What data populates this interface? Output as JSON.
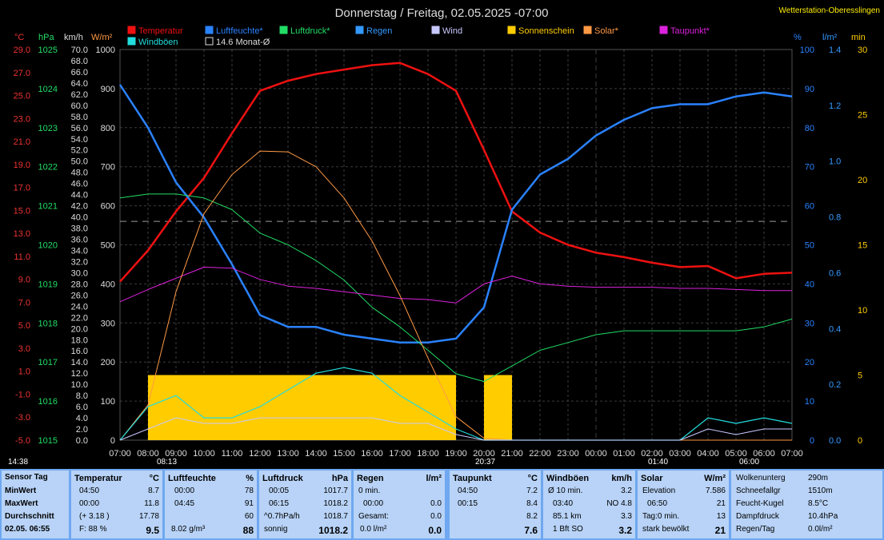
{
  "header": {
    "title": "Donnerstag / Freitag, 02.05.2025  -07:00",
    "station": "Wetterstation-Oberesslingen"
  },
  "legend": [
    {
      "label": "Temperatur",
      "color": "#ee1111"
    },
    {
      "label": "Luftfeuchte*",
      "color": "#2a82ff"
    },
    {
      "label": "Luftdruck*",
      "color": "#22dd66"
    },
    {
      "label": "Regen",
      "color": "#3399ff"
    },
    {
      "label": "Wind",
      "color": "#c8c8ff"
    },
    {
      "label": "Sonnenschein",
      "color": "#ffcc00"
    },
    {
      "label": "Solar*",
      "color": "#ff9944"
    },
    {
      "label": "Taupunkt*",
      "color": "#dd22dd"
    },
    {
      "label": "Windböen",
      "color": "#22dddd"
    },
    {
      "label": "14.6 Monat-Ø",
      "color": "#000000"
    }
  ],
  "axis_units": {
    "temp": "°C",
    "pressure": "hPa",
    "wind": "km/h",
    "solar": "W/m²",
    "humidity": "%",
    "rain": "l/m²",
    "minutes": "min"
  },
  "axis_labels": {
    "temp": [
      "29.0",
      "27.0",
      "25.0",
      "23.0",
      "21.0",
      "19.0",
      "17.0",
      "15.0",
      "13.0",
      "11.0",
      "9.0",
      "7.0",
      "5.0",
      "3.0",
      "1.0",
      "-1.0",
      "-3.0",
      "-5.0"
    ],
    "pressure": [
      "1025",
      "1024",
      "1023",
      "1022",
      "1021",
      "1020",
      "1019",
      "1018",
      "1017",
      "1016",
      "1015"
    ],
    "wind": [
      "70.0",
      "68.0",
      "66.0",
      "64.0",
      "62.0",
      "60.0",
      "58.0",
      "56.0",
      "54.0",
      "52.0",
      "50.0",
      "48.0",
      "46.0",
      "44.0",
      "42.0",
      "40.0",
      "38.0",
      "36.0",
      "34.0",
      "32.0",
      "30.0",
      "28.0",
      "26.0",
      "24.0",
      "22.0",
      "20.0",
      "18.0",
      "16.0",
      "14.0",
      "12.0",
      "10.0",
      "8.0",
      "6.0",
      "4.0",
      "2.0",
      "0.0"
    ],
    "solar": [
      "1000",
      "900",
      "800",
      "700",
      "600",
      "500",
      "400",
      "300",
      "200",
      "100",
      "0"
    ],
    "humidity": [
      "100",
      "90",
      "80",
      "70",
      "60",
      "50",
      "40",
      "30",
      "20",
      "10",
      "0"
    ],
    "rain": [
      "1.4",
      "1.2",
      "1.0",
      "0.8",
      "0.6",
      "0.4",
      "0.2",
      "0.0"
    ],
    "minutes": [
      "30",
      "25",
      "20",
      "15",
      "10",
      "5",
      "0"
    ],
    "time": [
      "07:00",
      "08:00",
      "09:00",
      "10:00",
      "11:00",
      "12:00",
      "13:00",
      "14:00",
      "15:00",
      "16:00",
      "17:00",
      "18:00",
      "19:00",
      "20:00",
      "21:00",
      "22:00",
      "23:00",
      "00:00",
      "01:00",
      "02:00",
      "03:00",
      "04:00",
      "05:00",
      "06:00",
      "07:00"
    ]
  },
  "markers": {
    "sunrise": "08:13",
    "sunset": "20:37",
    "moonrise": "01:40",
    "daylength": "14:38",
    "now": "06:00"
  },
  "chart_data": {
    "type": "line",
    "x_unit": "hours",
    "x_range": [
      "07:00",
      "07:00 (+1 day)"
    ],
    "x": [
      7,
      8,
      9,
      10,
      11,
      12,
      13,
      14,
      15,
      16,
      17,
      18,
      19,
      20,
      21,
      22,
      23,
      24,
      25,
      26,
      27,
      28,
      29,
      30,
      31
    ],
    "series": [
      {
        "name": "Temperatur",
        "unit": "°C",
        "values": [
          9.2,
          12.0,
          15.5,
          18.5,
          22.5,
          26.3,
          27.2,
          27.8,
          28.2,
          28.6,
          28.8,
          27.8,
          26.3,
          21.0,
          15.5,
          13.6,
          12.5,
          11.8,
          11.4,
          10.9,
          10.5,
          10.6,
          9.5,
          9.9,
          10.0
        ]
      },
      {
        "name": "Luftfeuchte*",
        "unit": "%",
        "values": [
          91,
          80,
          66,
          57,
          45,
          32,
          29,
          29,
          27,
          26,
          25,
          25,
          26,
          34,
          59,
          68,
          72,
          78,
          82,
          85,
          86,
          86,
          88,
          89,
          88
        ]
      },
      {
        "name": "Luftdruck*",
        "unit": "hPa",
        "values": [
          1021.2,
          1021.3,
          1021.3,
          1021.2,
          1020.9,
          1020.3,
          1020.0,
          1019.6,
          1019.1,
          1018.4,
          1017.9,
          1017.3,
          1016.7,
          1016.5,
          1016.9,
          1017.3,
          1017.5,
          1017.7,
          1017.8,
          1017.8,
          1017.8,
          1017.8,
          1017.8,
          1017.9,
          1018.1
        ]
      },
      {
        "name": "Taupunkt*",
        "unit": "°C",
        "values": [
          7.4,
          8.5,
          9.5,
          10.5,
          10.4,
          9.4,
          8.8,
          8.6,
          8.3,
          8.0,
          7.7,
          7.6,
          7.3,
          9.0,
          9.7,
          9.0,
          8.8,
          8.7,
          8.7,
          8.7,
          8.6,
          8.6,
          8.5,
          8.4,
          8.4
        ]
      },
      {
        "name": "Solar*",
        "unit": "W/m²",
        "values": [
          0,
          90,
          380,
          580,
          680,
          740,
          738,
          700,
          620,
          510,
          370,
          210,
          60,
          5,
          0,
          0,
          0,
          0,
          0,
          0,
          0,
          0,
          0,
          0,
          0
        ]
      },
      {
        "name": "Windböen",
        "unit": "km/h",
        "values": [
          0,
          6,
          8,
          4,
          4,
          6,
          9,
          12,
          13,
          12,
          8,
          5,
          2,
          0,
          0,
          0,
          0,
          0,
          0,
          0,
          0,
          4,
          3,
          4,
          3
        ]
      },
      {
        "name": "Wind",
        "unit": "km/h",
        "values": [
          0,
          2,
          4,
          3,
          3,
          4,
          4,
          4,
          4,
          4,
          3,
          3,
          1,
          0,
          0,
          0,
          0,
          0,
          0,
          0,
          0,
          2,
          1,
          2,
          2
        ]
      },
      {
        "name": "Sonnenschein",
        "unit": "min",
        "values": [
          0,
          5,
          5,
          5,
          5,
          5,
          5,
          5,
          5,
          5,
          5,
          5,
          0,
          5,
          0,
          0,
          0,
          0,
          0,
          0,
          0,
          0,
          0,
          0,
          0
        ]
      }
    ],
    "reference": {
      "name": "14.6 Monat-Ø",
      "unit": "°C",
      "value": 14.6
    },
    "ylim": {
      "temp": [
        -5,
        30
      ],
      "humidity": [
        0,
        100
      ],
      "pressure": [
        1015,
        1025
      ],
      "solar": [
        0,
        1000
      ],
      "wind": [
        0,
        70
      ],
      "minutes": [
        0,
        30
      ],
      "rain": [
        0,
        1.5
      ]
    },
    "grid": true
  },
  "stats": {
    "rows": [
      "Sensor Tag",
      "MinWert",
      "MaxWert",
      "Durchschnitt"
    ],
    "date": "02.05.  06:55",
    "temperature": {
      "title": "Temperatur",
      "unit": "°C",
      "min_time": "04:50",
      "min": "8.7",
      "max_time": "00:00",
      "max": "11.8",
      "avg_note": "(+ 3.18 )",
      "avg": "17.78",
      "extra": "F: 88 %",
      "current": "9.5"
    },
    "humidity": {
      "title": "Luftfeuchte",
      "unit": "%",
      "min_time": "00:00",
      "min": "78",
      "max_time": "04:45",
      "max": "91",
      "avg": "60",
      "extra": "8.02 g/m³",
      "current": "88"
    },
    "pressure": {
      "title": "Luftdruck",
      "unit": "hPa",
      "min_time": "00:05",
      "min": "1017.7",
      "max_time": "06:15",
      "max": "1018.2",
      "trend": "^0.7hPa/h",
      "avg": "1018.7",
      "extra": "sonnig",
      "current": "1018.2"
    },
    "rain": {
      "title": "Regen",
      "unit": "l/m²",
      "r1": "0 min.",
      "r1v": "",
      "r2": "00:00",
      "r2v": "0.0",
      "r3": "Gesamt:",
      "r3v": "0.0",
      "extra": "0.0 l/m²",
      "current": "0.0"
    },
    "dewpoint": {
      "title": "Taupunkt",
      "unit": "°C",
      "min_time": "04:50",
      "min": "7.2",
      "max_time": "00:15",
      "max": "8.4",
      "avg": "8.2",
      "current": "7.6"
    },
    "gusts": {
      "title": "Windböen",
      "unit": "km/h",
      "r1": "Ø 10 min.",
      "r1v": "3.2",
      "r2": "03:40",
      "r2v": "NO 4.8",
      "r3": "85.1 km",
      "r3v": "3.3",
      "extra": "1 Bft SO",
      "current": "3.2"
    },
    "solar": {
      "title": "Solar",
      "unit": "W/m²",
      "r1": "Elevation",
      "r1v": "7.586",
      "r2": "06:50",
      "r2v": "21",
      "r3": "Tag:0 min.",
      "r3v": "13",
      "extra": "stark bewölkt",
      "current": "21"
    },
    "misc": {
      "r1": "Wolkenunterg",
      "r1v": "290m",
      "r2": "Schneefallgr",
      "r2v": "1510m",
      "r3": "Feucht-Kugel",
      "r3v": "8.5°C",
      "r4": "Dampfdruck",
      "r4v": "10.4hPa",
      "r5": "Regen/Tag",
      "r5v": "0.0l/m²"
    }
  }
}
